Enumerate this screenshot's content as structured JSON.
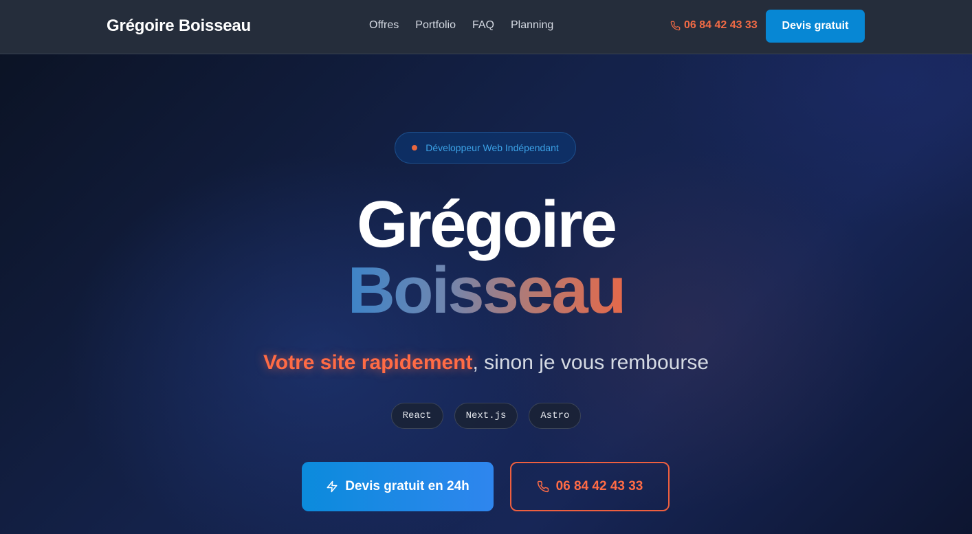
{
  "nav": {
    "brand": "Grégoire Boisseau",
    "links": [
      "Offres",
      "Portfolio",
      "FAQ",
      "Planning"
    ],
    "phone": "06 84 42 43 33",
    "phone_icon": "phone-icon",
    "cta_label": "Devis gratuit"
  },
  "hero": {
    "badge": "Développeur Web Indépendant",
    "title_first": "Grégoire",
    "title_last": "Boisseau",
    "tagline_highlight": "Votre site rapidement",
    "tagline_rest": ", sinon je vous rembourse",
    "tech_tags": [
      "React",
      "Next.js",
      "Astro"
    ],
    "primary_cta": "Devis gratuit en 24h",
    "primary_cta_icon": "lightning-icon",
    "secondary_cta": "06 84 42 43 33",
    "secondary_cta_icon": "phone-icon"
  },
  "colors": {
    "accent_orange": "#ff6b45",
    "accent_blue": "#0787d4",
    "navbar_bg": "#252d3b"
  }
}
